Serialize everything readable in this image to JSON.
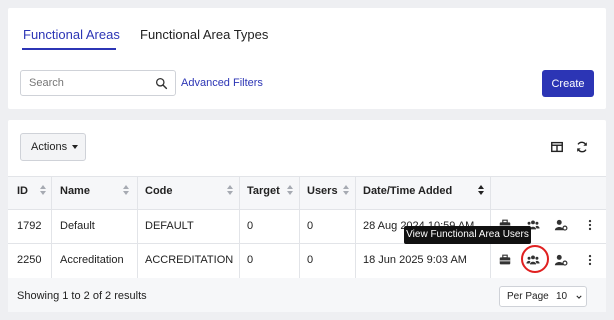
{
  "tabs": [
    {
      "label": "Functional Areas",
      "active": true
    },
    {
      "label": "Functional Area Types",
      "active": false
    }
  ],
  "search": {
    "placeholder": "Search",
    "value": ""
  },
  "filters": {
    "advanced_label": "Advanced Filters"
  },
  "create_label": "Create",
  "toolbar": {
    "actions_label": "Actions",
    "columns_icon": "columns-icon",
    "refresh_icon": "refresh-icon"
  },
  "table": {
    "columns": [
      "ID",
      "Name",
      "Code",
      "Target",
      "Users",
      "Date/Time Added"
    ],
    "sorted_column": "Date/Time Added",
    "sort_direction": "desc",
    "rows": [
      {
        "id": "1792",
        "name": "Default",
        "code": "DEFAULT",
        "target": "0",
        "users": "0",
        "date_added": "28 Aug 2024 10:59 AM"
      },
      {
        "id": "2250",
        "name": "Accreditation",
        "code": "ACCREDITATION",
        "target": "0",
        "users": "0",
        "date_added": "18 Jun 2025 9:03 AM"
      }
    ],
    "row_action_icons": [
      "briefcase-icon",
      "users-icon",
      "user-settings-icon",
      "more-vertical-icon"
    ]
  },
  "tooltip": "View Functional Area Users",
  "footer": {
    "showing": "Showing 1 to 2 of 2 results",
    "per_page_label": "Per Page",
    "per_page_value": "10"
  },
  "colors": {
    "accent": "#2c35b5",
    "highlight": "#e02020",
    "tooltip_bg": "#111111"
  }
}
